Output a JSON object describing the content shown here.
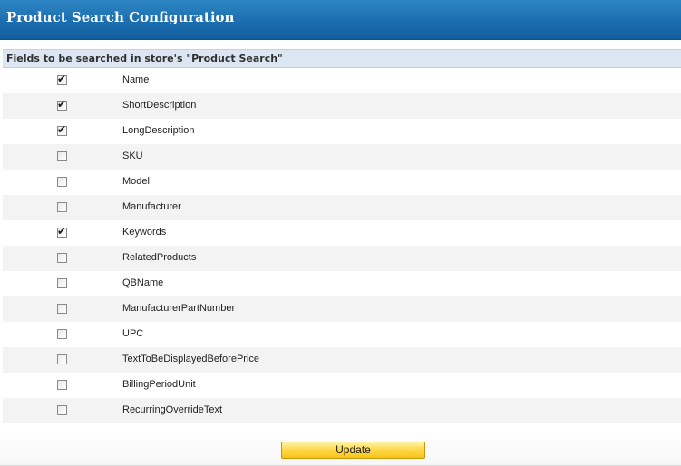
{
  "header": {
    "title": "Product Search Configuration"
  },
  "section": {
    "title": "Fields to be searched in store's \"Product Search\""
  },
  "fields": [
    {
      "label": "Name",
      "checked": true
    },
    {
      "label": "ShortDescription",
      "checked": true
    },
    {
      "label": "LongDescription",
      "checked": true
    },
    {
      "label": "SKU",
      "checked": false
    },
    {
      "label": "Model",
      "checked": false
    },
    {
      "label": "Manufacturer",
      "checked": false
    },
    {
      "label": "Keywords",
      "checked": true
    },
    {
      "label": "RelatedProducts",
      "checked": false
    },
    {
      "label": "QBName",
      "checked": false
    },
    {
      "label": "ManufacturerPartNumber",
      "checked": false
    },
    {
      "label": "UPC",
      "checked": false
    },
    {
      "label": "TextToBeDisplayedBeforePrice",
      "checked": false
    },
    {
      "label": "BillingPeriodUnit",
      "checked": false
    },
    {
      "label": "RecurringOverrideText",
      "checked": false
    }
  ],
  "footer": {
    "update_label": "Update"
  },
  "colors": {
    "header_blue": "#1b6eaf",
    "section_head_bg": "#dce6f3",
    "button_yellow": "#ffd94c"
  }
}
